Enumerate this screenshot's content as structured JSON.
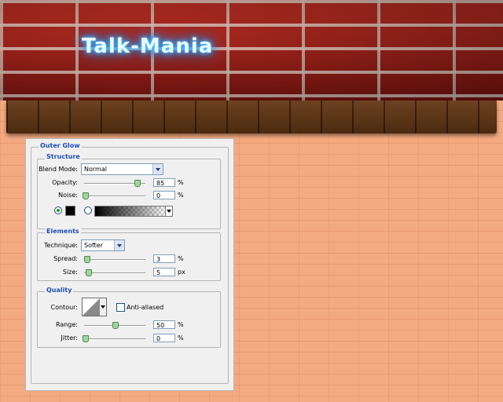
{
  "site": {
    "logo": "Talk-Mania"
  },
  "panel": {
    "title": "Outer Glow",
    "structure": {
      "title": "Structure",
      "blend_mode_label": "Blend Mode:",
      "blend_mode_value": "Normal",
      "opacity_label": "Opacity:",
      "opacity_value": "85",
      "noise_label": "Noise:",
      "noise_value": "0",
      "unit": "%"
    },
    "elements": {
      "title": "Elements",
      "technique_label": "Technique:",
      "technique_value": "Softer",
      "spread_label": "Spread:",
      "spread_value": "3",
      "spread_unit": "%",
      "size_label": "Size:",
      "size_value": "5",
      "size_unit": "px"
    },
    "quality": {
      "title": "Quality",
      "contour_label": "Contour:",
      "anti_aliased_label": "Anti-aliased",
      "range_label": "Range:",
      "range_value": "50",
      "jitter_label": "Jitter:",
      "jitter_value": "0",
      "unit": "%"
    },
    "colors": {
      "glow_color": "#000000",
      "title_blue": "#1d4fb8"
    }
  }
}
